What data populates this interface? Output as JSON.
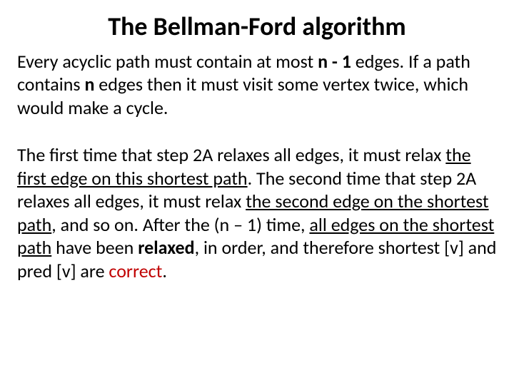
{
  "title": "The Bellman-Ford algorithm",
  "p1": {
    "t1": "Every acyclic path must contain at most ",
    "b1": "n - 1",
    "t2": " edges. If a path contains ",
    "b2": "n",
    "t3": " edges then it must visit some vertex twice, which would make a cycle."
  },
  "p2": {
    "t1": "The first time that step 2A relaxes all edges, it must relax ",
    "u1": "the first edge on this shortest path",
    "t2": ". The second time that step 2A relaxes all edges, it must relax ",
    "u2": "the second edge on the shortest path",
    "t3": ", and so on. After the (n – 1) time, ",
    "u3": "all edges on the shortest path",
    "t4": " have been ",
    "b1": "relaxed",
    "t5": ", in order, and therefore shortest [v] and pred [v] are ",
    "r1": "correct",
    "t6": "."
  }
}
